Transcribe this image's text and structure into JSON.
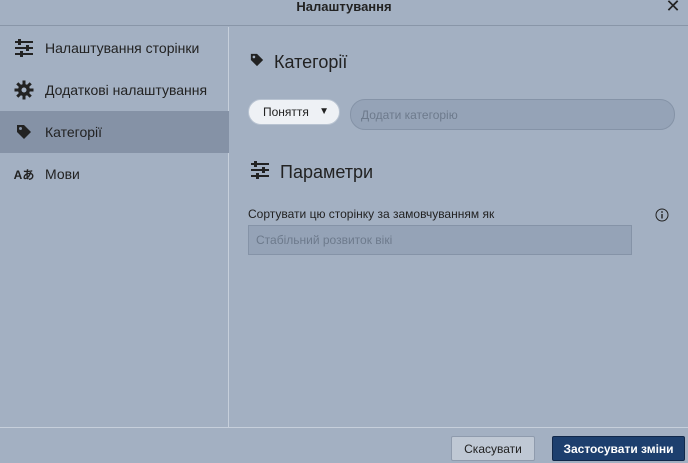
{
  "window": {
    "title": "Налаштування"
  },
  "sidebar": {
    "items": [
      {
        "label": "Налаштування сторінки",
        "icon": "sliders-icon",
        "active": false
      },
      {
        "label": "Додаткові налаштування",
        "icon": "gear-icon",
        "active": false
      },
      {
        "label": "Категорії",
        "icon": "tag-icon",
        "active": true
      },
      {
        "label": "Мови",
        "icon": "language-icon",
        "active": false
      }
    ]
  },
  "categories": {
    "heading": "Категорії",
    "select_value": "Поняття",
    "input_placeholder": "Додати категорію"
  },
  "parameters": {
    "heading": "Параметри",
    "sort_label": "Сортувати цю сторінку за замовчуванням як",
    "sort_placeholder": "Стабільний розвиток вікі"
  },
  "footer": {
    "cancel_label": "Скасувати",
    "apply_label": "Застосувати зміни"
  },
  "colors": {
    "background": "#a3b0c2",
    "active_item": "#8592a6",
    "primary_button": "#1d3f6e"
  }
}
